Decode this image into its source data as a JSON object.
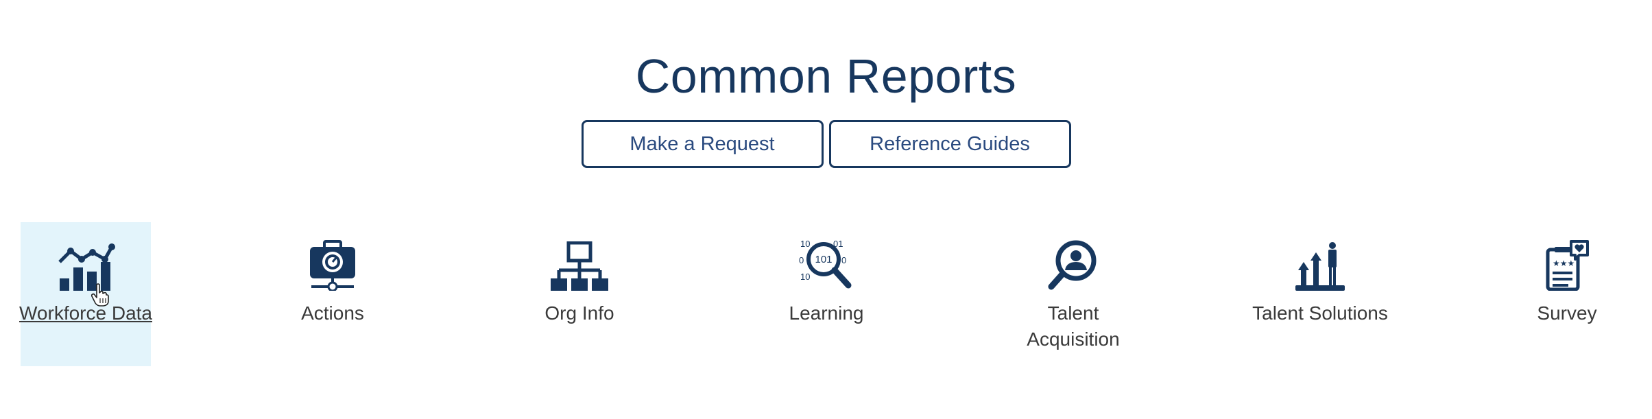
{
  "header": {
    "title": "Common Reports"
  },
  "buttons": {
    "make_request": "Make a Request",
    "reference_guides": "Reference Guides"
  },
  "tiles": [
    {
      "label": "Workforce Data",
      "icon": "chart-icon",
      "active": true
    },
    {
      "label": "Actions",
      "icon": "camera-icon",
      "active": false
    },
    {
      "label": "Org Info",
      "icon": "org-chart-icon",
      "active": false
    },
    {
      "label": "Learning",
      "icon": "magnifier-binary-icon",
      "active": false
    },
    {
      "label": "Talent Acquisition",
      "icon": "person-search-icon",
      "active": false
    },
    {
      "label": "Talent Solutions",
      "icon": "growth-arrows-icon",
      "active": false
    },
    {
      "label": "Survey",
      "icon": "survey-clipboard-icon",
      "active": false
    }
  ],
  "icons": {
    "learning_digits": "101"
  },
  "colors": {
    "brand": "#17375e",
    "active_tile_bg": "#e3f4fb",
    "label_text": "#3a3a3a"
  }
}
